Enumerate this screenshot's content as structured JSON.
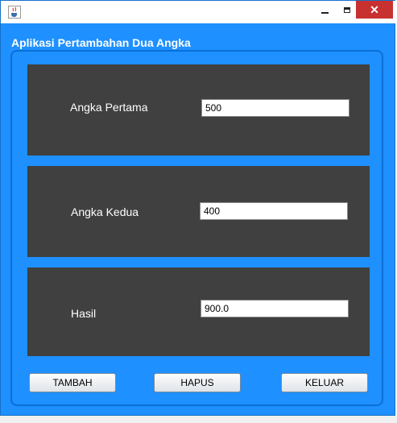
{
  "window": {
    "title": "",
    "icons": {
      "app": "java-cup-icon",
      "minimize": "minimize-icon",
      "maximize": "maximize-icon",
      "close": "close-icon"
    },
    "colors": {
      "background": "#1e90ff",
      "panel": "#404040",
      "close": "#c7312f"
    }
  },
  "panel": {
    "title": "Aplikasi Pertambahan Dua Angka"
  },
  "form": {
    "first_label": "Angka Pertama",
    "first_value": "500",
    "second_label": "Angka Kedua",
    "second_value": "400",
    "result_label": "Hasil",
    "result_value": "900.0"
  },
  "buttons": {
    "add": "TAMBAH",
    "clear": "HAPUS",
    "exit": "KELUAR"
  }
}
